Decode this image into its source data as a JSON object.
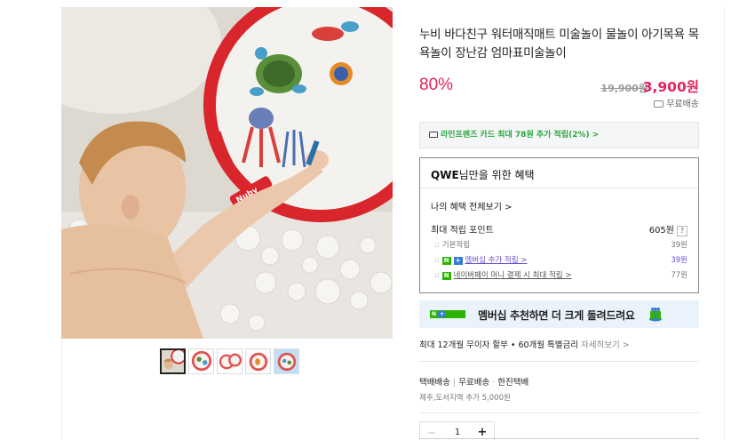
{
  "product": {
    "title": "누비 바다친구 워터매직매트 미술놀이 물놀이 아기목욕 목욕놀이 장난감 엄마표미술놀이",
    "discount": "80%",
    "original_price": "19,900원",
    "sale_price": "3,900원",
    "shipping": "무료배송"
  },
  "card_offer": "라인프렌즈 카드 최대 78원 추가 적립(2%) >",
  "benefit": {
    "title_name": "QWE",
    "title_rest": "님만을 위한 혜택",
    "all_link": "나의 혜택 전체보기 >",
    "points_label": "최대 적립 포인트",
    "points_value": "605원",
    "help": "?",
    "rows": [
      {
        "label": "기본적립",
        "value": "39원"
      },
      {
        "label": "멤버십 추가 적립 >",
        "value": "39원"
      },
      {
        "label": "네이버페이 머니 결제 시 최대 적립 >",
        "value": "77원"
      }
    ]
  },
  "promo": {
    "badge": "N + 멤버십",
    "text": "멤버십 추천하면 더 크게 돌려드려요"
  },
  "installment": {
    "text": "최대 12개월 무이자 할부 • 60개월 특별금리",
    "more": "자세히보기 >"
  },
  "delivery": {
    "type": "택배배송",
    "fee": "무료배송",
    "carrier": "한진택배",
    "extra": "제주,도서지역 추가 5,000원"
  },
  "quantity": {
    "minus": "−",
    "value": "1",
    "plus": "+"
  },
  "colors": {
    "accent": "#e3245d",
    "green": "#2db400",
    "blue": "#3a7bd5"
  }
}
